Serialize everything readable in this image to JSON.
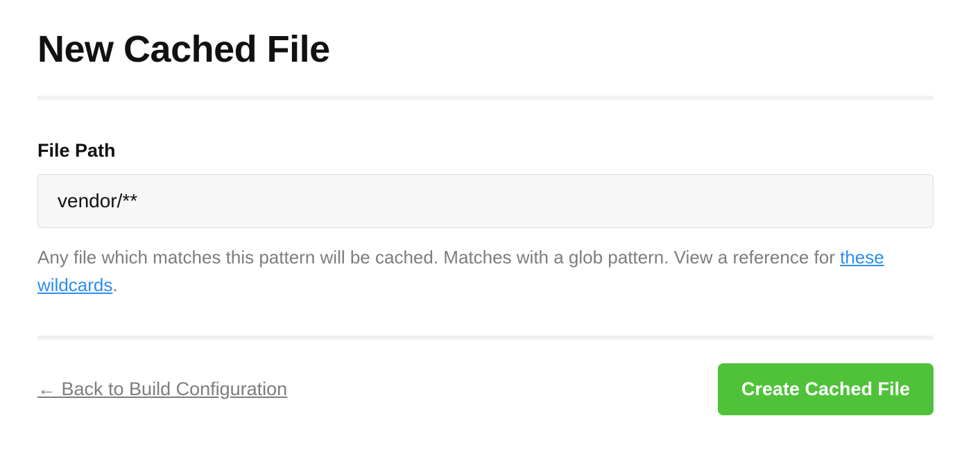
{
  "header": {
    "title": "New Cached File"
  },
  "form": {
    "file_path": {
      "label": "File Path",
      "value": "vendor/**",
      "help_text_prefix": "Any file which matches this pattern will be cached. Matches with a glob pattern. View a reference for ",
      "help_link_text": "these wildcards",
      "help_text_suffix": "."
    }
  },
  "footer": {
    "back_link": "← Back to Build Configuration",
    "submit_label": "Create Cached File"
  },
  "colors": {
    "primary_button_bg": "#4fc23a",
    "link": "#2b8ef0",
    "muted_text": "#7d7d7d",
    "input_bg": "#f7f7f7",
    "divider": "#f0f0f0"
  }
}
